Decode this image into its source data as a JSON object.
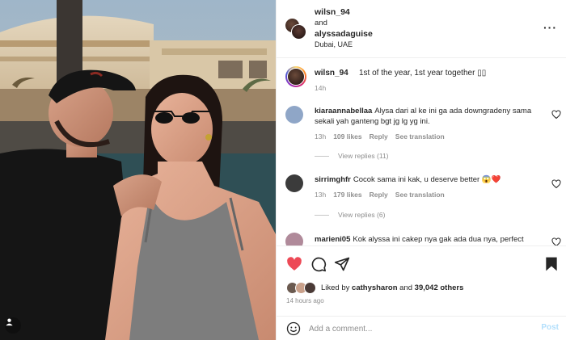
{
  "header": {
    "user1": "wilsn_94",
    "and_text": "and",
    "user2": "alyssadaguise",
    "location": "Dubai, UAE",
    "more_icon": "more-horizontal-icon"
  },
  "caption": {
    "username": "wilsn_94",
    "text": "1st of the year, 1st year together ▯▯",
    "time": "14h"
  },
  "comments": [
    {
      "username": "kiaraannabellaa",
      "text": "Alysa dari al ke ini ga ada downgradeny sama sekali yah ganteng bgt jg lg yg ini.",
      "time": "13h",
      "likes": "109 likes",
      "reply": "Reply",
      "translate": "See translation",
      "view_replies": "View replies (11)",
      "avatar_color": "#8fa6c7"
    },
    {
      "username": "sirrimghfr",
      "text": "Cocok sama ini kak, u deserve better",
      "emoji": "😱❤️",
      "time": "13h",
      "likes": "179 likes",
      "reply": "Reply",
      "translate": "See translation",
      "view_replies": "View replies (6)",
      "avatar_color": "#3b3b3b"
    },
    {
      "username": "marieni05",
      "text": "Kok alyssa ini cakep nya gak ada dua nya, perfect",
      "avatar_color": "#b08a9a"
    }
  ],
  "likes": {
    "prefix": "Liked by ",
    "user": "cathysharon",
    "middle": " and ",
    "count": "39,042 others"
  },
  "post_time": "14 hours ago",
  "composer": {
    "placeholder": "Add a comment...",
    "post_label": "Post"
  },
  "colors": {
    "like_red": "#ed4956",
    "muted": "#8e8e8e",
    "post_disabled": "#b2dffc"
  }
}
